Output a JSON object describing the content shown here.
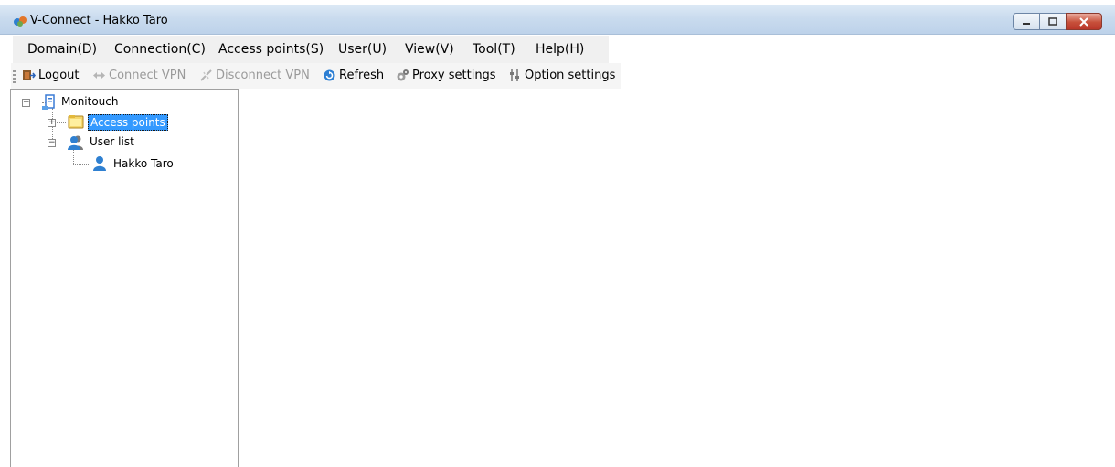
{
  "window": {
    "title": "V-Connect - Hakko Taro"
  },
  "menu": [
    "Domain(D)",
    "Connection(C)",
    "Access points(S)",
    "User(U)",
    "View(V)",
    "Tool(T)",
    "Help(H)"
  ],
  "toolbar": {
    "logout": "Logout",
    "connect_vpn": "Connect VPN",
    "disconnect_vpn": "Disconnect VPN",
    "refresh": "Refresh",
    "proxy_settings": "Proxy settings",
    "option_settings": "Option settings"
  },
  "tree": {
    "root": "Monitouch",
    "access_points": "Access points",
    "user_list": "User list",
    "user": "Hakko Taro"
  }
}
